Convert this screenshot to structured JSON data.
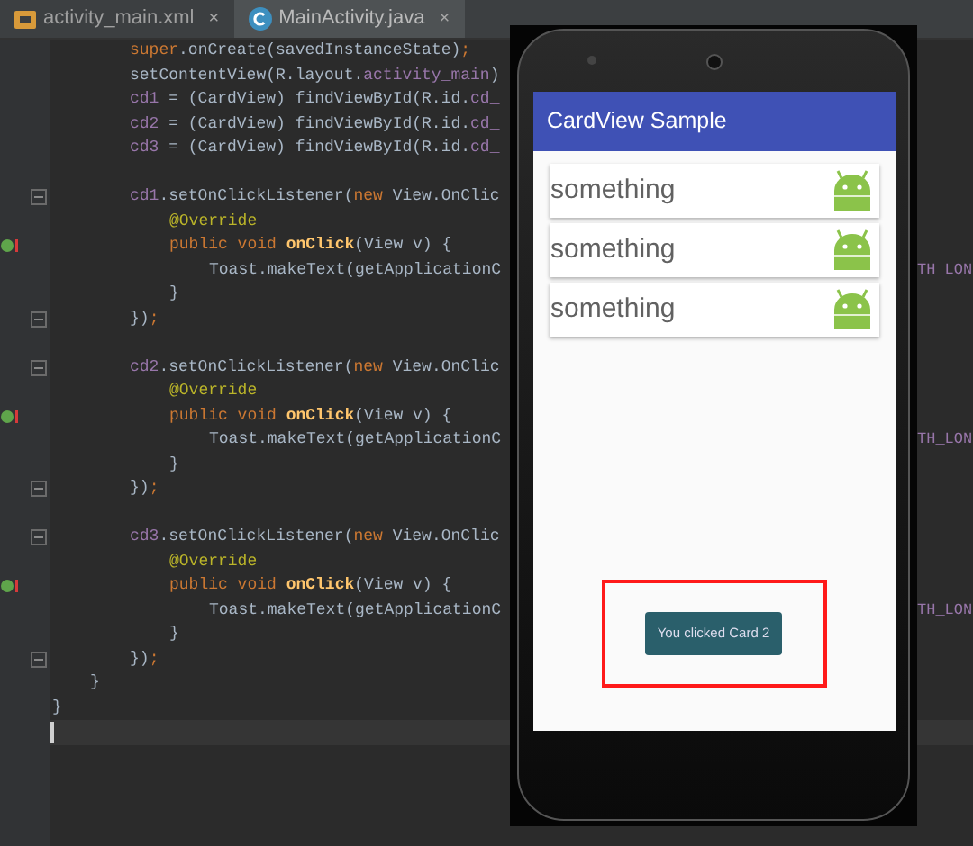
{
  "tabs": [
    {
      "label": "activity_main.xml",
      "kind": "xml",
      "close": "×",
      "selected": false
    },
    {
      "label": "MainActivity.java",
      "kind": "class",
      "close": "×",
      "selected": true
    }
  ],
  "code_lines": [
    {
      "kind": "statement",
      "segments": [
        {
          "kind": "keyword",
          "text": "super"
        },
        {
          "kind": "plain",
          "text": ".onCreate(savedInstanceState)"
        },
        {
          "kind": "keyword",
          "text": ";"
        }
      ]
    },
    {
      "kind": "statement",
      "segments": [
        {
          "kind": "plain",
          "text": "setContentView(R.layout."
        },
        {
          "kind": "field",
          "text": "activity_main"
        },
        {
          "kind": "plain",
          "text": ")"
        }
      ]
    },
    {
      "kind": "statement",
      "segments": [
        {
          "kind": "field",
          "text": "cd1"
        },
        {
          "kind": "plain",
          "text": " = (CardView) findViewById(R.id."
        },
        {
          "kind": "field",
          "text": "cd_"
        }
      ]
    },
    {
      "kind": "statement",
      "segments": [
        {
          "kind": "field",
          "text": "cd2"
        },
        {
          "kind": "plain",
          "text": " = (CardView) findViewById(R.id."
        },
        {
          "kind": "field",
          "text": "cd_"
        }
      ]
    },
    {
      "kind": "statement",
      "segments": [
        {
          "kind": "field",
          "text": "cd3"
        },
        {
          "kind": "plain",
          "text": " = (CardView) findViewById(R.id."
        },
        {
          "kind": "field",
          "text": "cd_"
        }
      ]
    },
    {
      "kind": "blank"
    },
    {
      "kind": "statement",
      "fold": true,
      "segments": [
        {
          "kind": "field",
          "text": "cd1"
        },
        {
          "kind": "plain",
          "text": ".setOnClickListener("
        },
        {
          "kind": "keyword",
          "text": "new "
        },
        {
          "kind": "plain",
          "text": "View.OnClic"
        }
      ]
    },
    {
      "kind": "member",
      "segments": [
        {
          "kind": "annotation",
          "text": "@Override"
        }
      ]
    },
    {
      "kind": "member",
      "override": true,
      "segments": [
        {
          "kind": "keyword",
          "text": "public void "
        },
        {
          "kind": "method",
          "text": "onClick"
        },
        {
          "kind": "plain",
          "text": "(View v) {"
        }
      ]
    },
    {
      "kind": "body",
      "tail": "TH_LON",
      "segments": [
        {
          "kind": "plain",
          "text": "Toast.makeText(getApplicationC"
        }
      ]
    },
    {
      "kind": "member",
      "segments": [
        {
          "kind": "plain",
          "text": "}"
        }
      ]
    },
    {
      "kind": "statement",
      "fold": true,
      "segments": [
        {
          "kind": "plain",
          "text": "})"
        },
        {
          "kind": "keyword",
          "text": ";"
        }
      ]
    },
    {
      "kind": "blank"
    },
    {
      "kind": "statement",
      "fold": true,
      "segments": [
        {
          "kind": "field",
          "text": "cd2"
        },
        {
          "kind": "plain",
          "text": ".setOnClickListener("
        },
        {
          "kind": "keyword",
          "text": "new "
        },
        {
          "kind": "plain",
          "text": "View.OnClic"
        }
      ]
    },
    {
      "kind": "member",
      "segments": [
        {
          "kind": "annotation",
          "text": "@Override"
        }
      ]
    },
    {
      "kind": "member",
      "override": true,
      "segments": [
        {
          "kind": "keyword",
          "text": "public void "
        },
        {
          "kind": "method",
          "text": "onClick"
        },
        {
          "kind": "plain",
          "text": "(View v) {"
        }
      ]
    },
    {
      "kind": "body",
      "tail": "TH_LON",
      "segments": [
        {
          "kind": "plain",
          "text": "Toast.makeText(getApplicationC"
        }
      ]
    },
    {
      "kind": "member",
      "segments": [
        {
          "kind": "plain",
          "text": "}"
        }
      ]
    },
    {
      "kind": "statement",
      "fold": true,
      "segments": [
        {
          "kind": "plain",
          "text": "})"
        },
        {
          "kind": "keyword",
          "text": ";"
        }
      ]
    },
    {
      "kind": "blank"
    },
    {
      "kind": "statement",
      "fold": true,
      "segments": [
        {
          "kind": "field",
          "text": "cd3"
        },
        {
          "kind": "plain",
          "text": ".setOnClickListener("
        },
        {
          "kind": "keyword",
          "text": "new "
        },
        {
          "kind": "plain",
          "text": "View.OnClic"
        }
      ]
    },
    {
      "kind": "member",
      "segments": [
        {
          "kind": "annotation",
          "text": "@Override"
        }
      ]
    },
    {
      "kind": "member",
      "override": true,
      "segments": [
        {
          "kind": "keyword",
          "text": "public void "
        },
        {
          "kind": "method",
          "text": "onClick"
        },
        {
          "kind": "plain",
          "text": "(View v) {"
        }
      ]
    },
    {
      "kind": "body",
      "tail": "TH_LON",
      "segments": [
        {
          "kind": "plain",
          "text": "Toast.makeText(getApplicationC"
        }
      ]
    },
    {
      "kind": "member",
      "segments": [
        {
          "kind": "plain",
          "text": "}"
        }
      ]
    },
    {
      "kind": "statement",
      "fold": true,
      "segments": [
        {
          "kind": "plain",
          "text": "})"
        },
        {
          "kind": "keyword",
          "text": ";"
        }
      ]
    },
    {
      "kind": "method_end",
      "segments": [
        {
          "kind": "plain",
          "text": "}"
        }
      ]
    },
    {
      "kind": "class_end",
      "segments": [
        {
          "kind": "plain",
          "text": "}"
        }
      ]
    },
    {
      "kind": "cursor"
    }
  ],
  "phone": {
    "app_bar_title": "CardView Sample",
    "cards": [
      {
        "text": "something"
      },
      {
        "text": "something"
      },
      {
        "text": "something"
      }
    ],
    "toast": "You clicked Card 2",
    "highlighted": true
  }
}
